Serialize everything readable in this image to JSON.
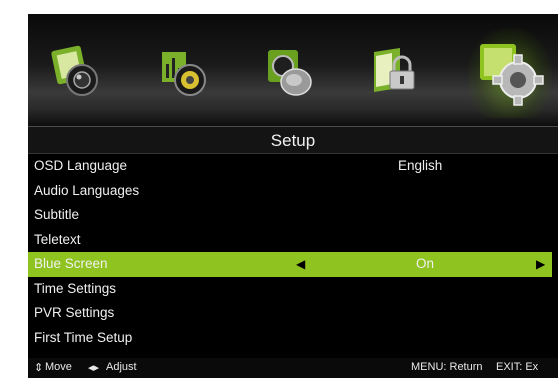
{
  "header": {
    "title": "Setup"
  },
  "tabs": [
    {
      "name": "picture-tab-icon",
      "active": false
    },
    {
      "name": "sound-tab-icon",
      "active": false
    },
    {
      "name": "channel-tab-icon",
      "active": false
    },
    {
      "name": "lock-tab-icon",
      "active": false
    },
    {
      "name": "setup-tab-icon",
      "active": true
    }
  ],
  "menu": {
    "items": [
      {
        "label": "OSD Language",
        "value": "English"
      },
      {
        "label": "Audio Languages",
        "value": ""
      },
      {
        "label": "Subtitle",
        "value": ""
      },
      {
        "label": "Teletext",
        "value": ""
      },
      {
        "label": "Blue Screen",
        "value": "On",
        "selected": true
      },
      {
        "label": "Time Settings",
        "value": ""
      },
      {
        "label": "PVR Settings",
        "value": ""
      },
      {
        "label": "First Time Setup",
        "value": ""
      }
    ]
  },
  "hints": {
    "move": "Move",
    "adjust": "Adjust",
    "menu": "MENU: Return",
    "exit": "EXIT: Ex"
  },
  "colors": {
    "accent": "#8fc320",
    "background": "#000000",
    "text": "#f0f0f0"
  }
}
